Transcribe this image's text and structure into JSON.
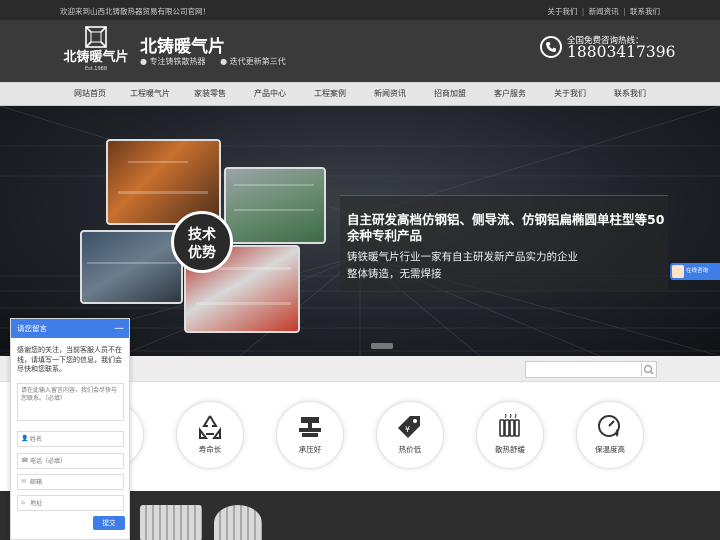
{
  "topbar": {
    "welcome": "欢迎来到山西北铸散热器贸易有限公司官网！",
    "links": [
      "关于我们",
      "新闻资讯",
      "联系我们"
    ],
    "separator": "|"
  },
  "header": {
    "logo_text": "北铸暖气片",
    "logo_est": "Est.1988",
    "brand": "北铸暖气片",
    "slogans": [
      "● 专注铸铁散热器",
      "● 迭代更新第三代"
    ],
    "hotline_label": "全国免费咨询热线：",
    "hotline_number": "18803417396"
  },
  "nav": {
    "items": [
      "网站首页",
      "工程暖气片",
      "家装零售",
      "产品中心",
      "工程案例",
      "新闻资讯",
      "招商加盟",
      "客户服务",
      "关于我们",
      "联系我们"
    ]
  },
  "banner": {
    "badge": [
      "技术",
      "优势"
    ],
    "headline": "自主研发高档仿钢铝、侧导流、仿钢铝扁椭圆单柱型等50余种专利产品",
    "sub1": "铸铁暖气片行业一家有自主研发新产品实力的企业",
    "sub2": "整体铸造，无需焊接"
  },
  "features": [
    {
      "label": "",
      "icon": "partial-icon"
    },
    {
      "label": "寿命长",
      "icon": "recycle-icon"
    },
    {
      "label": "承压好",
      "icon": "press-icon"
    },
    {
      "label": "热价低",
      "icon": "price-tag-icon"
    },
    {
      "label": "散热舒缓",
      "icon": "radiator-icon"
    },
    {
      "label": "保温度高",
      "icon": "gauge-icon"
    }
  ],
  "chat": {
    "title": "请您留言",
    "minimize": "—",
    "message": "感谢您的关注，当前客服人员不在线，请填写一下您的信息，我们会尽快和您联系。",
    "textarea_placeholder": "请在此输入留言内容，我们会尽快与您联系。（必填）",
    "name_placeholder": "姓名",
    "phone_placeholder": "电话（必填）",
    "email_placeholder": "邮箱",
    "address_placeholder": "地址",
    "submit": "提交"
  },
  "online": {
    "label": "在线咨询"
  },
  "colors": {
    "accent": "#3f7ee8",
    "dark": "#2b2b2b"
  }
}
